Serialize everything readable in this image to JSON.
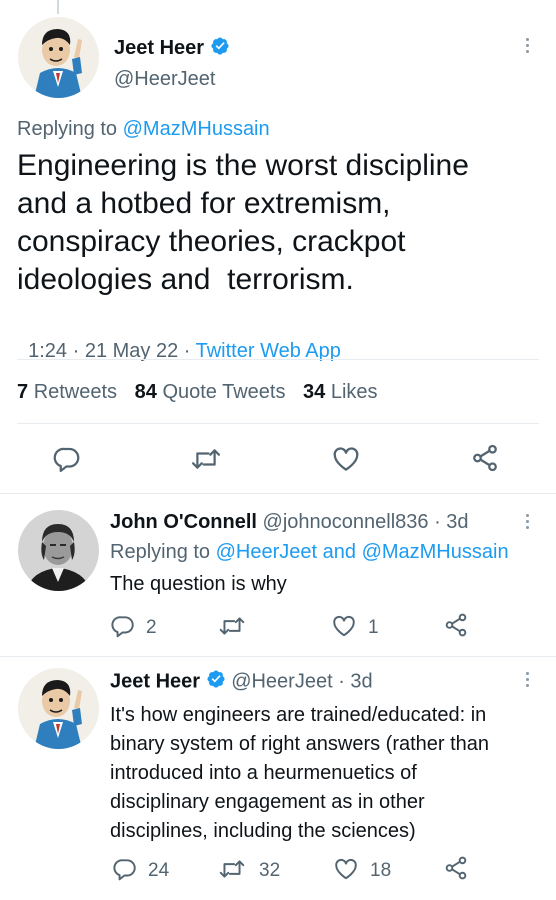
{
  "main_tweet": {
    "author_name": "Jeet Heer",
    "handle": "@HeerJeet",
    "replying_prefix": "Replying to",
    "replying_to": "@MazMHussain",
    "text_lines": [
      "Engineering is the worst discipline",
      "and a hotbed for extremism,",
      "conspiracy theories, crackpot",
      "ideologies and  terrorism."
    ],
    "time": "1:24 · 21 May 22 · ",
    "source": "Twitter Web App",
    "stats": {
      "retweets_count": "7",
      "retweets_label": "Retweets",
      "quotes_count": "84",
      "quotes_label": "Quote Tweets",
      "likes_count": "34",
      "likes_label": "Likes"
    },
    "icons": [
      "reply-icon",
      "retweet-icon",
      "like-icon",
      "share-icon"
    ]
  },
  "replies": [
    {
      "author_name": "John O'Connell",
      "meta": "@johnoconnell836 · 3d",
      "replying_prefix": "Replying to",
      "replying_to": "@HeerJeet and @MazMHussain",
      "text_lines": [
        "The question is why"
      ],
      "reply_count": "2",
      "retweet_count": "",
      "like_count": "1"
    },
    {
      "author_name": "Jeet Heer",
      "meta": "@HeerJeet · 3d",
      "text_lines": [
        "It's how engineers are trained/educated: in",
        "binary system of right answers (rather than",
        "introduced into a heurmenuetics of",
        "disciplinary engagement as in other",
        "disciplines, including the sciences)"
      ],
      "reply_count": "24",
      "retweet_count": "32",
      "like_count": "18"
    }
  ],
  "colors": {
    "accent": "#1d9bf0",
    "secondary": "#536471",
    "text": "#0f1419",
    "divider": "#e6ecf0"
  }
}
